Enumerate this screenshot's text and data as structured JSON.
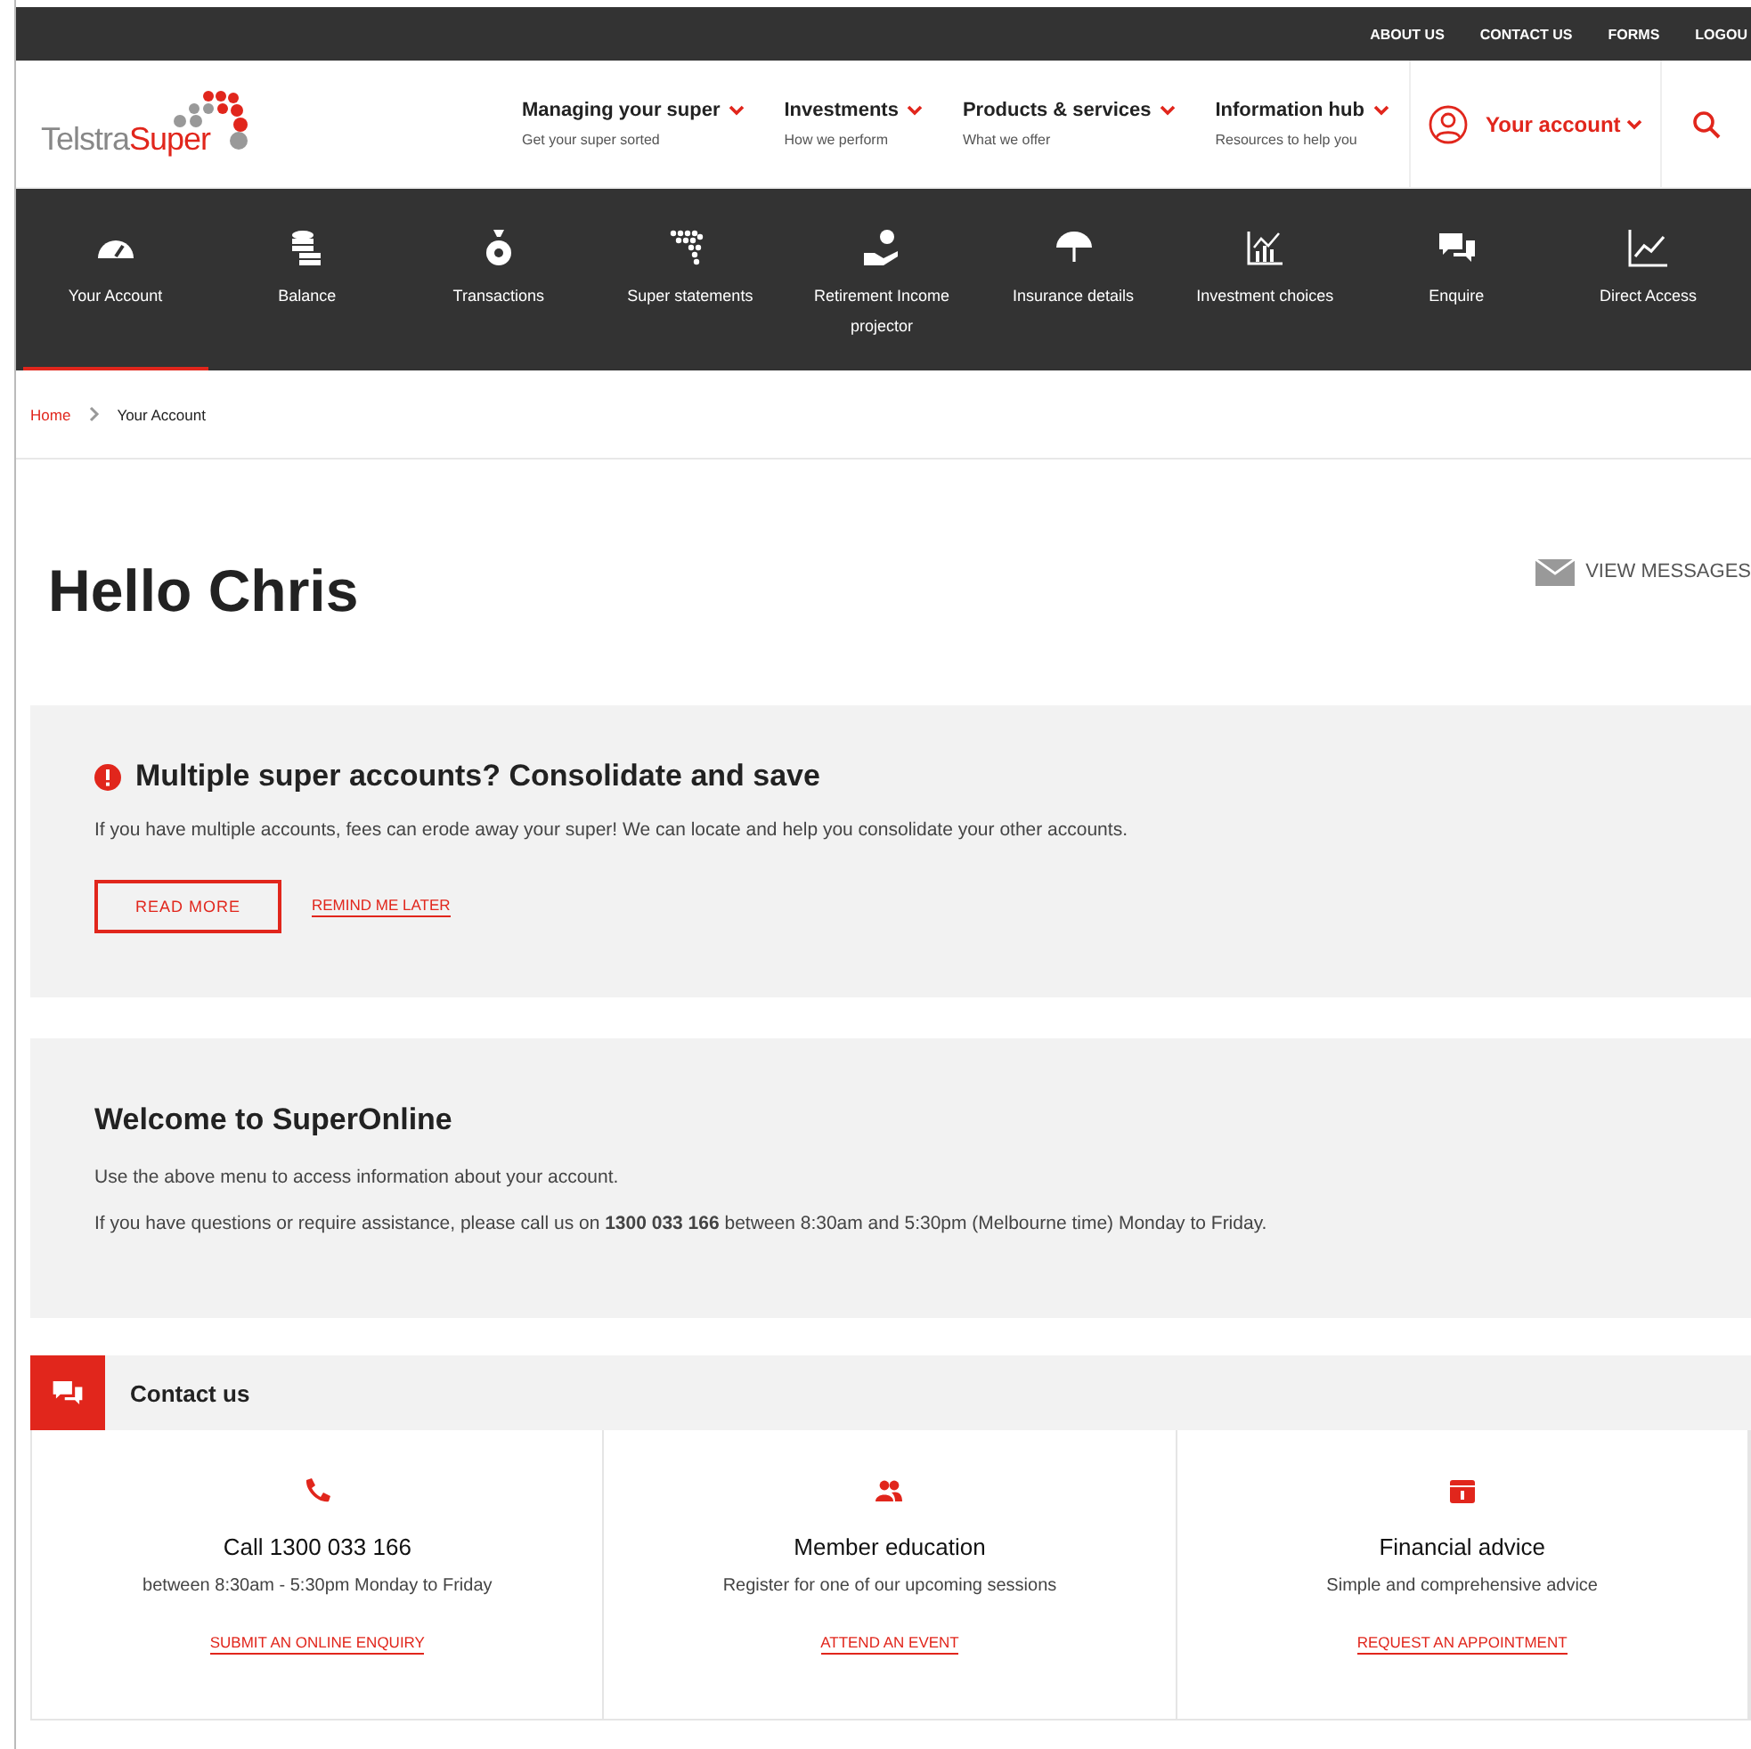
{
  "utility_links": [
    "ABOUT US",
    "CONTACT US",
    "FORMS",
    "LOGOU"
  ],
  "logo": {
    "part_1": "Telstra",
    "part_2": "Super"
  },
  "main_nav": [
    {
      "label": "Managing your super",
      "sub": "Get your super sorted"
    },
    {
      "label": "Investments",
      "sub": "How we perform"
    },
    {
      "label": "Products & services",
      "sub": "What we offer"
    },
    {
      "label": "Information hub",
      "sub": "Resources to help you"
    }
  ],
  "account_menu": {
    "label": "Your account"
  },
  "section_nav": [
    {
      "label": "Your Account",
      "selected": true
    },
    {
      "label": "Balance",
      "selected": false
    },
    {
      "label": "Transactions",
      "selected": false
    },
    {
      "label": "Super statements",
      "selected": false
    },
    {
      "label": "Retirement Income projector",
      "selected": false
    },
    {
      "label": "Insurance details",
      "selected": false
    },
    {
      "label": "Investment choices",
      "selected": false
    },
    {
      "label": "Enquire",
      "selected": false
    },
    {
      "label": "Direct Access",
      "selected": false
    }
  ],
  "breadcrumb": [
    "Home",
    "Your Account"
  ],
  "greeting": "Hello Chris",
  "view_messages": "VIEW MESSAGES",
  "alert": {
    "title": "Multiple super accounts? Consolidate and save",
    "text": "If you have multiple accounts, fees can erode away your super! We can locate and help you consolidate your other accounts.",
    "primary": "READ MORE",
    "secondary": "REMIND ME LATER"
  },
  "welcome": {
    "title": "Welcome to SuperOnline",
    "paragraphs": [
      "Use the above menu to access information about your account.",
      "If you have questions or require assistance, please call us on **1300 033 166** between 8:30am and 5:30pm (Melbourne time) Monday to Friday."
    ]
  },
  "contact": {
    "title": "Contact us",
    "cards": [
      {
        "title": "Call 1300 033 166",
        "text": "between 8:30am - 5:30pm Monday to Friday",
        "link": "SUBMIT AN ONLINE ENQUIRY"
      },
      {
        "title": "Member education",
        "text": "Register for one of our upcoming sessions",
        "link": "ATTEND AN EVENT"
      },
      {
        "title": "Financial advice",
        "text": "Simple and comprehensive advice",
        "link": "REQUEST AN APPOINTMENT"
      }
    ]
  }
}
